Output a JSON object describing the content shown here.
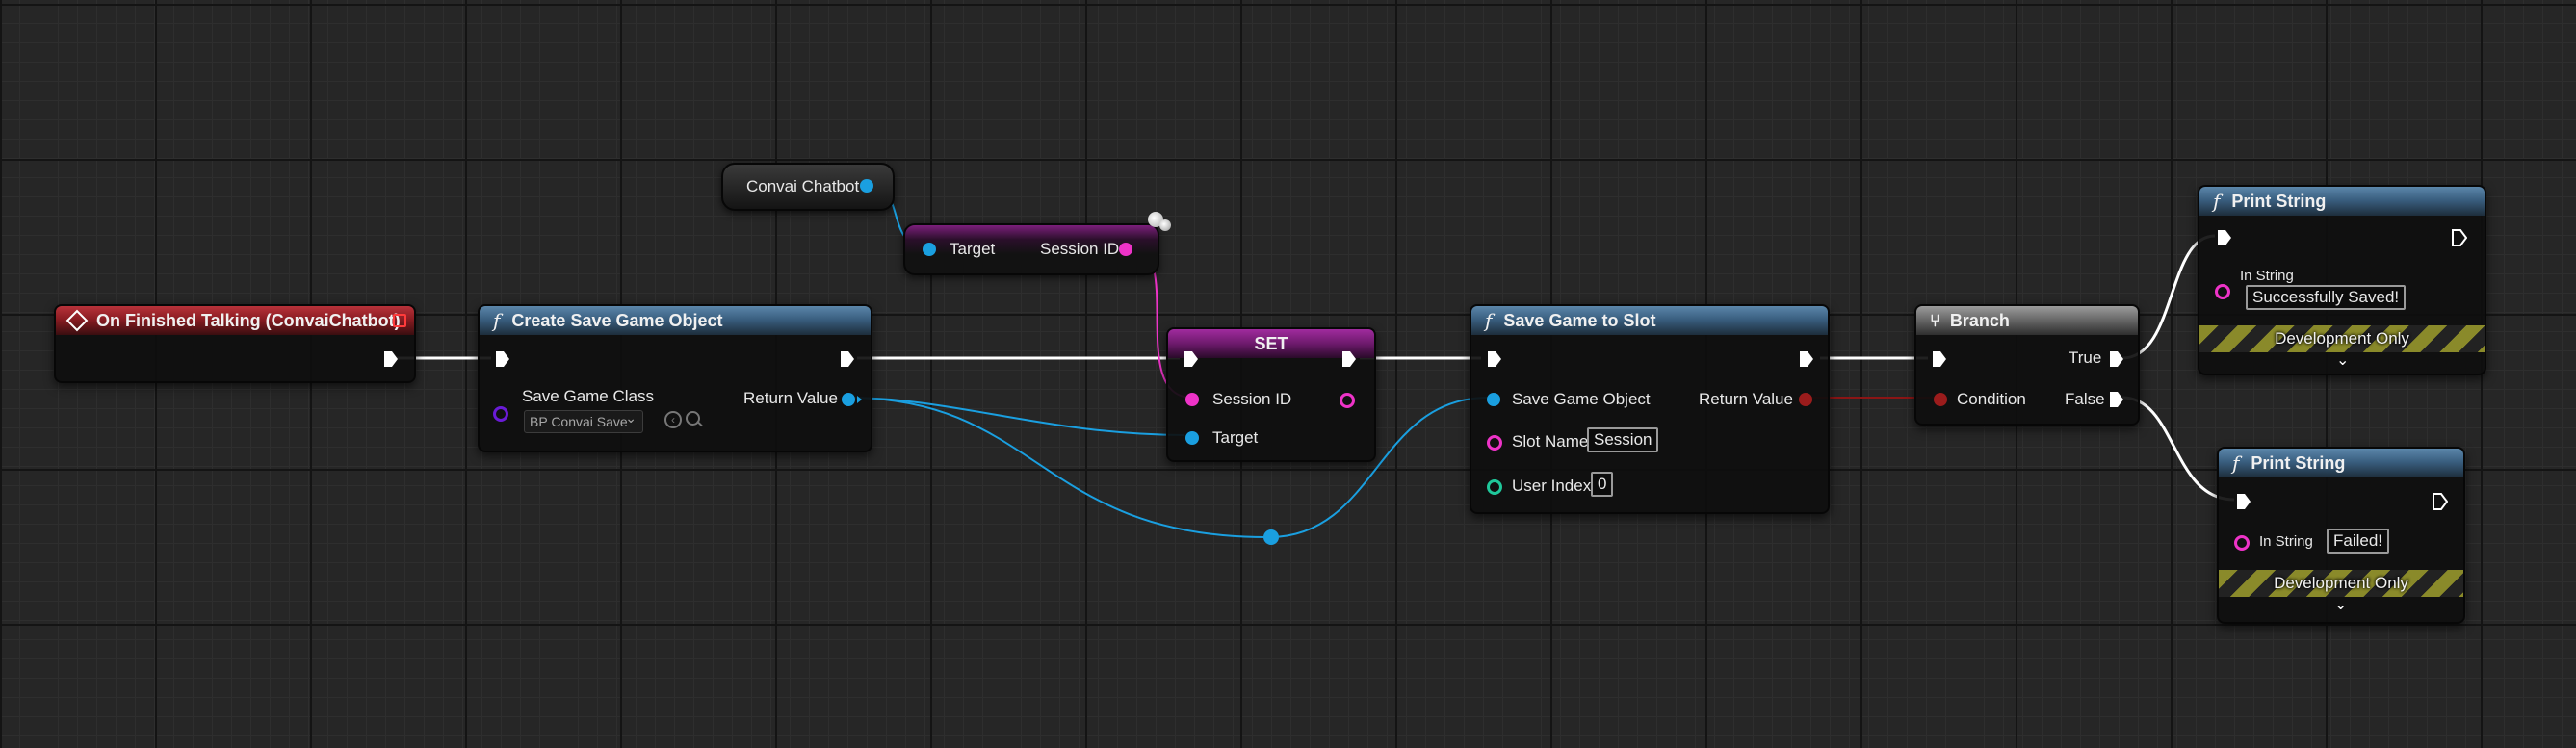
{
  "colors": {
    "exec": "#ffffff",
    "object_pin": "#1a9fe0",
    "string_pin": "#ee33c8",
    "bool_pin": "#9b1c1c",
    "int_pin": "#1fc79a",
    "class_pin": "#6a1bd6"
  },
  "nodes": {
    "event": {
      "title": "On Finished Talking (ConvaiChatbot)"
    },
    "create_save": {
      "title": "Create Save Game Object",
      "save_game_class_label": "Save Game Class",
      "save_game_class_value": "BP Convai Save",
      "return_value_label": "Return Value"
    },
    "convai_chatbot": {
      "label": "Convai Chatbot"
    },
    "get_session": {
      "target_label": "Target",
      "session_label": "Session ID"
    },
    "set": {
      "title": "SET",
      "session_label": "Session ID",
      "target_label": "Target"
    },
    "save_slot": {
      "title": "Save Game to Slot",
      "save_obj_label": "Save Game Object",
      "return_value_label": "Return Value",
      "slot_name_label": "Slot Name",
      "slot_name_value": "Session",
      "user_index_label": "User Index",
      "user_index_value": "0"
    },
    "branch": {
      "title": "Branch",
      "true_label": "True",
      "condition_label": "Condition",
      "false_label": "False"
    },
    "print_success": {
      "title": "Print String",
      "in_string_label": "In String",
      "in_string_value": "Successfully Saved!",
      "dev_only": "Development Only",
      "expand_icon": "chevron-down"
    },
    "print_failed": {
      "title": "Print String",
      "in_string_label": "In String",
      "in_string_value": "Failed!",
      "dev_only": "Development Only",
      "expand_icon": "chevron-down"
    }
  }
}
